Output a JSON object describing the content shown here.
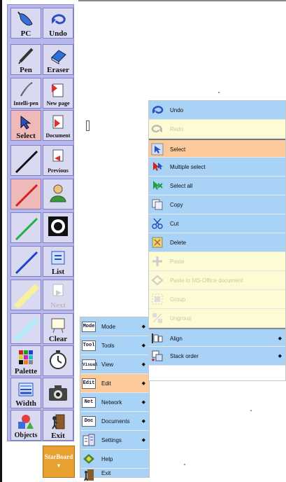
{
  "toolbar": {
    "buttons": [
      {
        "label": "PC",
        "icon": "pc-mouse-icon"
      },
      {
        "label": "Undo",
        "icon": "undo-arrow-icon"
      },
      {
        "label": "Pen",
        "icon": "pen-icon"
      },
      {
        "label": "Eraser",
        "icon": "eraser-icon"
      },
      {
        "label": "Intelli-pen",
        "icon": "intelli-pen-icon"
      },
      {
        "label": "New page",
        "icon": "new-page-icon"
      },
      {
        "label": "Select",
        "icon": "select-cursor-icon"
      },
      {
        "label": "Document",
        "icon": "document-icon"
      },
      {
        "label": "",
        "icon": "black-line-icon"
      },
      {
        "label": "Previous",
        "icon": "previous-page-icon"
      },
      {
        "label": "",
        "icon": "red-line-icon"
      },
      {
        "label": "",
        "icon": "person-icon"
      },
      {
        "label": "",
        "icon": "green-line-icon"
      },
      {
        "label": "",
        "icon": "camera-lens-icon"
      },
      {
        "label": "",
        "icon": "blue-line-icon"
      },
      {
        "label": "List",
        "icon": "list-icon"
      },
      {
        "label": "",
        "icon": "yellow-highlighter-icon"
      },
      {
        "label": "Next",
        "icon": "next-page-icon"
      },
      {
        "label": "",
        "icon": "cyan-highlighter-icon"
      },
      {
        "label": "Clear",
        "icon": "clear-board-icon"
      },
      {
        "label": "Palette",
        "icon": "palette-icon"
      },
      {
        "label": "",
        "icon": "stopwatch-icon"
      },
      {
        "label": "Width",
        "icon": "width-icon"
      },
      {
        "label": "",
        "icon": "camera-icon"
      },
      {
        "label": "Objects",
        "icon": "objects-shapes-icon"
      },
      {
        "label": "Exit",
        "icon": "exit-door-icon"
      }
    ],
    "starboard_label": "StarBoard"
  },
  "main_menu": {
    "items": [
      {
        "label": "Mode",
        "badge": "Mode",
        "submenu": true
      },
      {
        "label": "Tools",
        "badge": "Tool",
        "submenu": true
      },
      {
        "label": "View",
        "badge": "Visual",
        "submenu": true
      },
      {
        "label": "Edit",
        "badge": "Edit",
        "submenu": true
      },
      {
        "label": "Network",
        "badge": "Net",
        "submenu": true
      },
      {
        "label": "Documents",
        "badge": "Doc",
        "submenu": true
      },
      {
        "label": "Settings",
        "icon": "settings-icon",
        "submenu": true
      },
      {
        "label": "Help",
        "icon": "help-icon",
        "submenu": false
      },
      {
        "label": "Exit",
        "icon": "exit-icon",
        "submenu": false
      }
    ]
  },
  "edit_menu": {
    "items": [
      {
        "label": "Undo",
        "icon": "undo-icon",
        "state": "enabled"
      },
      {
        "label": "Redo",
        "icon": "redo-icon",
        "state": "disabled"
      },
      {
        "label": "Select",
        "icon": "select-icon",
        "state": "selected"
      },
      {
        "label": "Multiple select",
        "icon": "multiple-select-icon",
        "state": "enabled"
      },
      {
        "label": "Select all",
        "icon": "select-all-icon",
        "state": "enabled"
      },
      {
        "label": "Copy",
        "icon": "copy-icon",
        "state": "enabled"
      },
      {
        "label": "Cut",
        "icon": "cut-icon",
        "state": "enabled"
      },
      {
        "label": "Delete",
        "icon": "delete-icon",
        "state": "enabled"
      },
      {
        "label": "Paste",
        "icon": "paste-icon",
        "state": "disabled"
      },
      {
        "label": "Paste to MS-Office document",
        "icon": "paste-office-icon",
        "state": "disabled"
      },
      {
        "label": "Group",
        "icon": "group-icon",
        "state": "disabled"
      },
      {
        "label": "Ungroup",
        "icon": "ungroup-icon",
        "state": "disabled"
      },
      {
        "label": "Align",
        "icon": "align-icon",
        "state": "enabled",
        "submenu": true
      },
      {
        "label": "Stack order",
        "icon": "stack-order-icon",
        "state": "enabled",
        "submenu": true
      }
    ]
  },
  "colors": {
    "toolbar_bg": "#b7b7ec",
    "menu_blue": "#a9d2f7",
    "menu_disabled": "#fdfbd3",
    "menu_selected": "#fcca9a",
    "starboard": "#e8a030"
  }
}
